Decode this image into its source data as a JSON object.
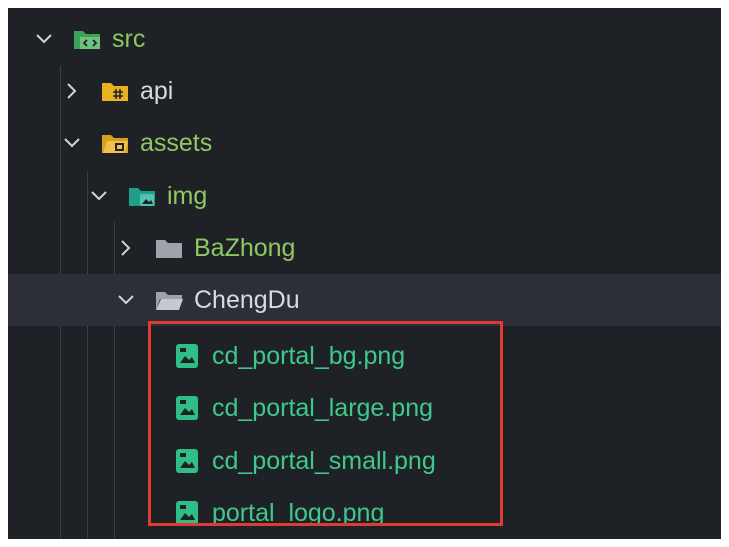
{
  "colors": {
    "background": "#1e2227",
    "highlight_row": "#2c3036",
    "folder_label": "#8fc860",
    "default_label": "#d7dae0",
    "file_label": "#3ec98b",
    "selection_border": "#e03a35"
  },
  "tree": {
    "src": {
      "label": "src",
      "icon": "folder-code-icon",
      "expanded": true
    },
    "api": {
      "label": "api",
      "icon": "folder-api-icon",
      "expanded": false
    },
    "assets": {
      "label": "assets",
      "icon": "folder-assets-icon",
      "expanded": true
    },
    "img": {
      "label": "img",
      "icon": "folder-images-icon",
      "expanded": true
    },
    "bazhong": {
      "label": "BaZhong",
      "icon": "folder-icon",
      "expanded": false
    },
    "chengdu": {
      "label": "ChengDu",
      "icon": "folder-open-icon",
      "expanded": true
    },
    "files": [
      {
        "label": "cd_portal_bg.png",
        "icon": "image-file-icon"
      },
      {
        "label": "cd_portal_large.png",
        "icon": "image-file-icon"
      },
      {
        "label": "cd_portal_small.png",
        "icon": "image-file-icon"
      },
      {
        "label": "portal_logo.png",
        "icon": "image-file-icon"
      }
    ]
  }
}
